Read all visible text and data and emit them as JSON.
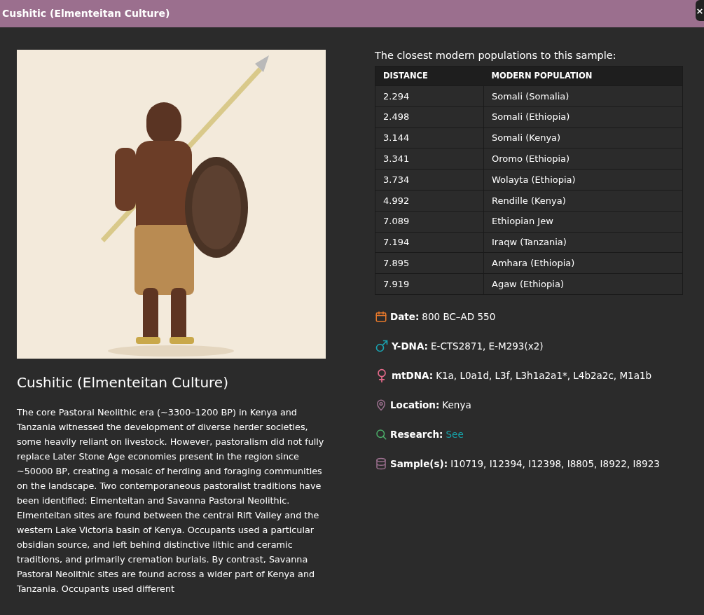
{
  "header": {
    "title": "Cushitic (Elmenteitan Culture)",
    "close": "×"
  },
  "sample": {
    "title": "Cushitic (Elmenteitan Culture)",
    "description": "The core Pastoral Neolithic era (~3300–1200 BP) in Kenya and Tanzania witnessed the development of diverse herder societies, some heavily reliant on livestock. However, pastoralism did not fully replace Later Stone Age economies present in the region since ~50000 BP, creating a mosaic of herding and foraging communities on the landscape. Two contemporaneous pastoralist traditions have been identified: Elmenteitan and Savanna Pastoral Neolithic. Elmenteitan sites are found between the central Rift Valley and the western Lake Victoria basin of Kenya. Occupants used a particular obsidian source, and left behind distinctive lithic and ceramic traditions, and primarily cremation burials. By contrast, Savanna Pastoral Neolithic sites are found across a wider part of Kenya and Tanzania. Occupants used different"
  },
  "table": {
    "caption": "The closest modern populations to this sample:",
    "columns": [
      "DISTANCE",
      "MODERN POPULATION"
    ],
    "rows": [
      [
        "2.294",
        "Somali (Somalia)"
      ],
      [
        "2.498",
        "Somali (Ethiopia)"
      ],
      [
        "3.144",
        "Somali (Kenya)"
      ],
      [
        "3.341",
        "Oromo (Ethiopia)"
      ],
      [
        "3.734",
        "Wolayta (Ethiopia)"
      ],
      [
        "4.992",
        "Rendille (Kenya)"
      ],
      [
        "7.089",
        "Ethiopian Jew"
      ],
      [
        "7.194",
        "Iraqw (Tanzania)"
      ],
      [
        "7.895",
        "Amhara (Ethiopia)"
      ],
      [
        "7.919",
        "Agaw (Ethiopia)"
      ]
    ]
  },
  "details": [
    {
      "kind": "date",
      "label": "Date:",
      "value": "800 BC–AD 550"
    },
    {
      "kind": "ydna",
      "label": "Y-DNA:",
      "value": "E-CTS2871, E-M293(x2)"
    },
    {
      "kind": "mtdna",
      "label": "mtDNA:",
      "value": "K1a, L0a1d, L3f, L3h1a2a1*, L4b2a2c, M1a1b"
    },
    {
      "kind": "location",
      "label": "Location:",
      "value": "Kenya"
    },
    {
      "kind": "research",
      "label": "Research:",
      "link": "See"
    },
    {
      "kind": "samples",
      "label": "Sample(s):",
      "value": "I10719, I12394, I12398, I8805, I8922, I8923"
    }
  ]
}
